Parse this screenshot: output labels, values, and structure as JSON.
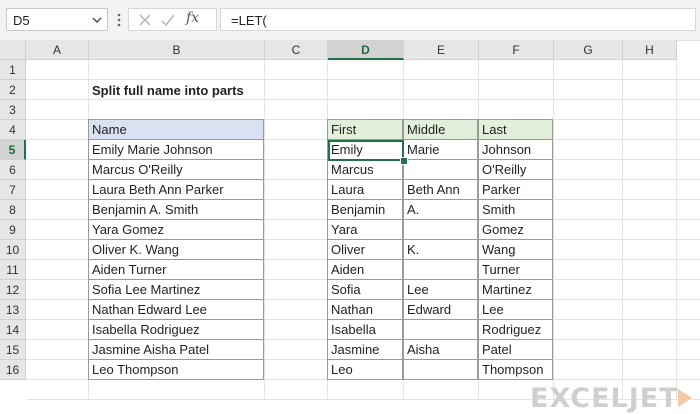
{
  "formula_bar": {
    "name_box": "D5",
    "fx_label": "fx",
    "formula": "=LET("
  },
  "columns": [
    "A",
    "B",
    "C",
    "D",
    "E",
    "F",
    "G",
    "H"
  ],
  "rows": [
    "1",
    "2",
    "3",
    "4",
    "5",
    "6",
    "7",
    "8",
    "9",
    "10",
    "11",
    "12",
    "13",
    "14",
    "15",
    "16"
  ],
  "active_cell": "D5",
  "title": "Split full name into parts",
  "name_table": {
    "header": "Name",
    "values": [
      "Emily Marie Johnson",
      "Marcus O'Reilly",
      "Laura Beth Ann Parker",
      "Benjamin A. Smith",
      "Yara Gomez",
      "Oliver K. Wang",
      "Aiden Turner",
      "Sofia Lee Martinez",
      "Nathan Edward Lee",
      "Isabella Rodriguez",
      "Jasmine Aisha Patel",
      "Leo Thompson"
    ]
  },
  "parts_table": {
    "headers": [
      "First",
      "Middle",
      "Last"
    ],
    "rows": [
      [
        "Emily",
        "Marie",
        "Johnson"
      ],
      [
        "Marcus",
        "",
        "O'Reilly"
      ],
      [
        "Laura",
        "Beth Ann",
        "Parker"
      ],
      [
        "Benjamin",
        "A.",
        "Smith"
      ],
      [
        "Yara",
        "",
        "Gomez"
      ],
      [
        "Oliver",
        "K.",
        "Wang"
      ],
      [
        "Aiden",
        "",
        "Turner"
      ],
      [
        "Sofia",
        "Lee",
        "Martinez"
      ],
      [
        "Nathan",
        "Edward",
        "Lee"
      ],
      [
        "Isabella",
        "",
        "Rodriguez"
      ],
      [
        "Jasmine",
        "Aisha",
        "Patel"
      ],
      [
        "Leo",
        "",
        "Thompson"
      ]
    ]
  },
  "watermark": "EXCELJET",
  "colors": {
    "accent_green": "#217346",
    "name_header_bg": "#d9e1f2",
    "parts_header_bg": "#e2efda"
  }
}
